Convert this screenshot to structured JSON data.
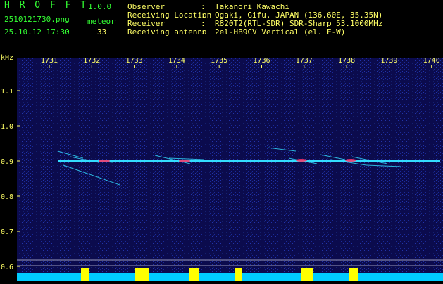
{
  "header": {
    "app_title": "H R O F F T",
    "app_version": "1.0.0",
    "file_name": "2510121730.png",
    "meteor_label": "meteor",
    "capture_date": "25.10.12 17:30",
    "meteor_count": "33",
    "info": [
      {
        "key": "Observer",
        "value": "Takanori Kawachi"
      },
      {
        "key": "Receiving Location",
        "value": "Ogaki, Gifu, JAPAN (136.60E, 35.35N)"
      },
      {
        "key": "Receiver",
        "value": "R820T2(RTL-SDR) SDR-Sharp 53.1000MHz"
      },
      {
        "key": "Receiving antenna",
        "value": "2el-HB9CV Vertical (el. E-W)"
      }
    ]
  },
  "spectrogram": {
    "y_unit": "kHz",
    "y_ticks": [
      "1.1",
      "1.0",
      "0.9",
      "0.8",
      "0.7",
      "0.6"
    ],
    "x_ticks": [
      "1731",
      "1732",
      "1733",
      "1734",
      "1735",
      "1736",
      "1737",
      "1738",
      "1739",
      "1740"
    ],
    "colors": {
      "background": "#0a0a4a",
      "signal": "#33ddff",
      "hot": "#ff3366",
      "text": "#ffff66",
      "activity": "#ffff00",
      "baseline": "#00ccff"
    }
  }
}
